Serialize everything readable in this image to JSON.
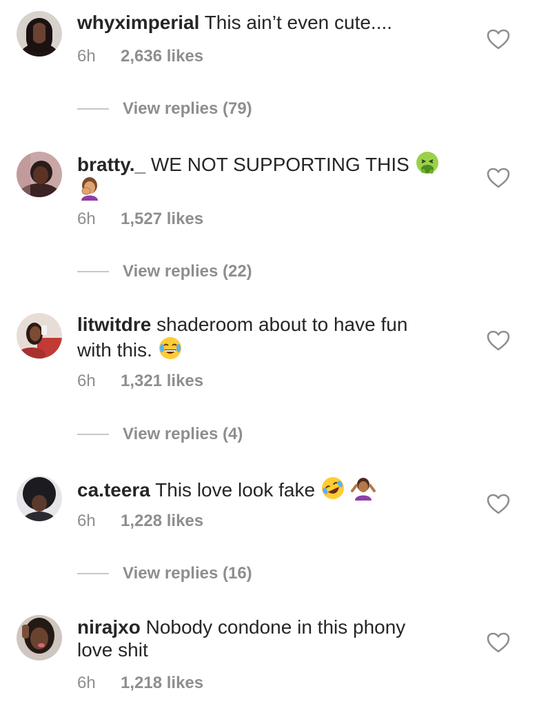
{
  "comments": [
    {
      "username": "whyximperial",
      "text": "This ain’t even cute....",
      "text_line2": "",
      "time": "6h",
      "likes": "2,636 likes",
      "replies": "View replies (79)",
      "avatar_color": "#2a1d18"
    },
    {
      "username": "bratty._",
      "text": "WE NOT SUPPORTING THIS",
      "text_line2": "",
      "time": "6h",
      "likes": "1,527 likes",
      "replies": "View replies (22)",
      "avatar_color": "#5a3a3a",
      "emojis": [
        "nauseated-face-emoji",
        "woman-facepalming-emoji"
      ]
    },
    {
      "username": "litwitdre",
      "text": "shaderoom about to have fun",
      "text_line2": "with this.",
      "time": "6h",
      "likes": "1,321 likes",
      "replies": "View replies (4)",
      "avatar_color": "#8a2f2f",
      "emojis": [
        "face-with-tears-of-joy-emoji"
      ]
    },
    {
      "username": "ca.teera",
      "text": "This love look fake",
      "text_line2": "",
      "time": "6h",
      "likes": "1,228 likes",
      "replies": "View replies (16)",
      "avatar_color": "#4a4a52",
      "emojis": [
        "rolling-on-floor-laughing-emoji",
        "person-shrugging-emoji"
      ]
    },
    {
      "username": "nirajxo",
      "text": "Nobody condone in this phony",
      "text_line2": "love shit",
      "time": "6h",
      "likes": "1,218 likes",
      "replies": "",
      "avatar_color": "#3a2c26"
    }
  ],
  "colors": {
    "text": "#262626",
    "muted": "#8e8e8e",
    "divider": "#c7c7c7",
    "heart_outline": "#8e8e8e"
  },
  "icons": {
    "like": "heart-outline-icon"
  }
}
